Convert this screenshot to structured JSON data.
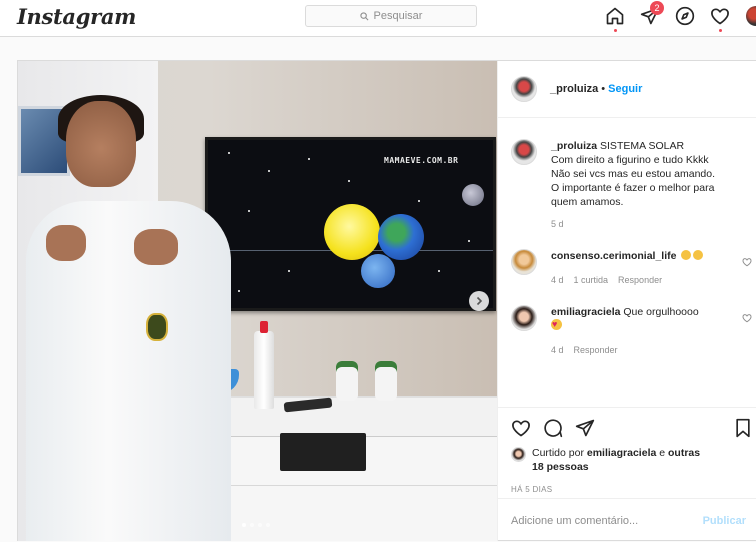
{
  "topbar": {
    "logo": "Instagram",
    "search_placeholder": "Pesquisar",
    "notifications_count": "2"
  },
  "post": {
    "media": {
      "tv_brand": "MAMAEVE.COM.BR",
      "carousel_position": 1,
      "carousel_count": 4
    },
    "author": {
      "username": "_proluiza",
      "separator": "•",
      "follow_label": "Seguir"
    },
    "caption": {
      "username": "_proluiza",
      "text": "SISTEMA SOLAR\nCom direito a figurino e tudo Kkkk\nNão sei vcs mas eu estou amando.\nO importante é fazer o melhor para quem amamos.",
      "time": "5 d"
    },
    "comments": [
      {
        "username": "consenso.cerimonial_life",
        "text": "",
        "time": "4 d",
        "likes": "1 curtida",
        "reply_label": "Responder"
      },
      {
        "username": "emiliagraciela",
        "text": "Que orgulhoooo",
        "time": "4 d",
        "reply_label": "Responder"
      }
    ],
    "likes_text_prefix": "Curtido por ",
    "likes_user": "emiliagraciela",
    "likes_text_mid": " e",
    "likes_others": "outras 18 pessoas",
    "posted_ago": "HÁ 5 DIAS",
    "add_comment_placeholder": "Adicione um comentário...",
    "publish_label": "Publicar"
  },
  "colors": {
    "accent": "#0095f6",
    "notification": "#ed4956",
    "publish_disabled": "#b2dffc"
  }
}
